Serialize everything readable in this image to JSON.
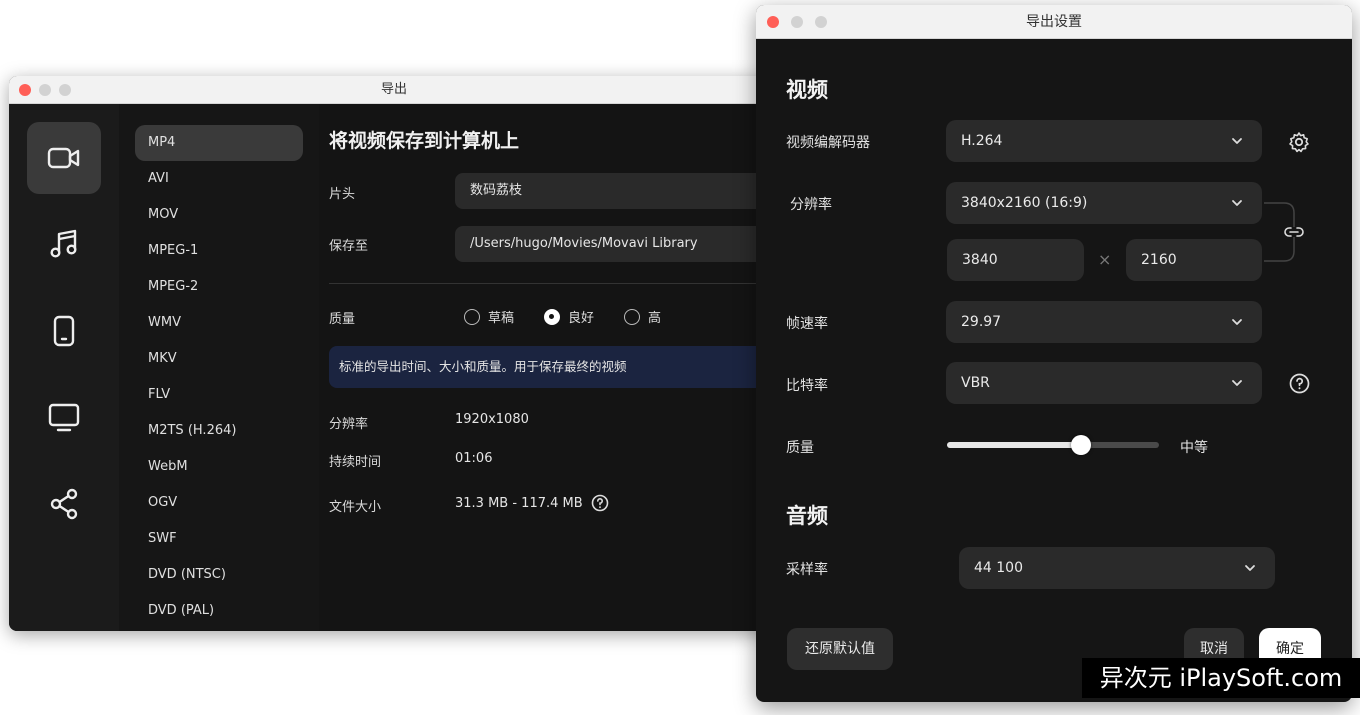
{
  "export_window": {
    "title": "导出",
    "nav_icons": [
      "video-icon",
      "music-icon",
      "phone-icon",
      "tv-icon",
      "share-icon"
    ],
    "formats": [
      "MP4",
      "AVI",
      "MOV",
      "MPEG-1",
      "MPEG-2",
      "WMV",
      "MKV",
      "FLV",
      "M2TS (H.264)",
      "WebM",
      "OGV",
      "SWF",
      "DVD (NTSC)",
      "DVD (PAL)"
    ],
    "heading": "将视频保存到计算机上",
    "title_label": "片头",
    "title_value": "数码荔枝",
    "save_to_label": "保存至",
    "save_to_value": "/Users/hugo/Movies/Movavi Library",
    "quality_label": "质量",
    "quality_options": [
      "草稿",
      "良好",
      "高"
    ],
    "quality_selected": "良好",
    "info_text": "标准的导出时间、大小和质量。用于保存最终的视频",
    "resolution_label": "分辨率",
    "resolution_value": "1920x1080",
    "duration_label": "持续时间",
    "duration_value": "01:06",
    "filesize_label": "文件大小",
    "filesize_value": "31.3 MB - 117.4 MB"
  },
  "settings_window": {
    "title": "导出设置",
    "video_section": "视频",
    "codec_label": "视频编解码器",
    "codec_value": "H.264",
    "resolution_label": "分辨率",
    "resolution_value": "3840x2160 (16:9)",
    "width_value": "3840",
    "times": "×",
    "height_value": "2160",
    "framerate_label": "帧速率",
    "framerate_value": "29.97",
    "bitrate_label": "比特率",
    "bitrate_value": "VBR",
    "quality_label": "质量",
    "quality_level": 0.63,
    "quality_value": "中等",
    "audio_section": "音频",
    "samplerate_label": "采样率",
    "samplerate_value": "44 100",
    "reset_button": "还原默认值",
    "cancel_button": "取消",
    "ok_button": "确定"
  },
  "watermark": "异次元 iPlaySoft.com",
  "colors": {
    "accent_info": "#1b2440",
    "window_bg": "#151515",
    "close_red": "#ff5f57"
  }
}
